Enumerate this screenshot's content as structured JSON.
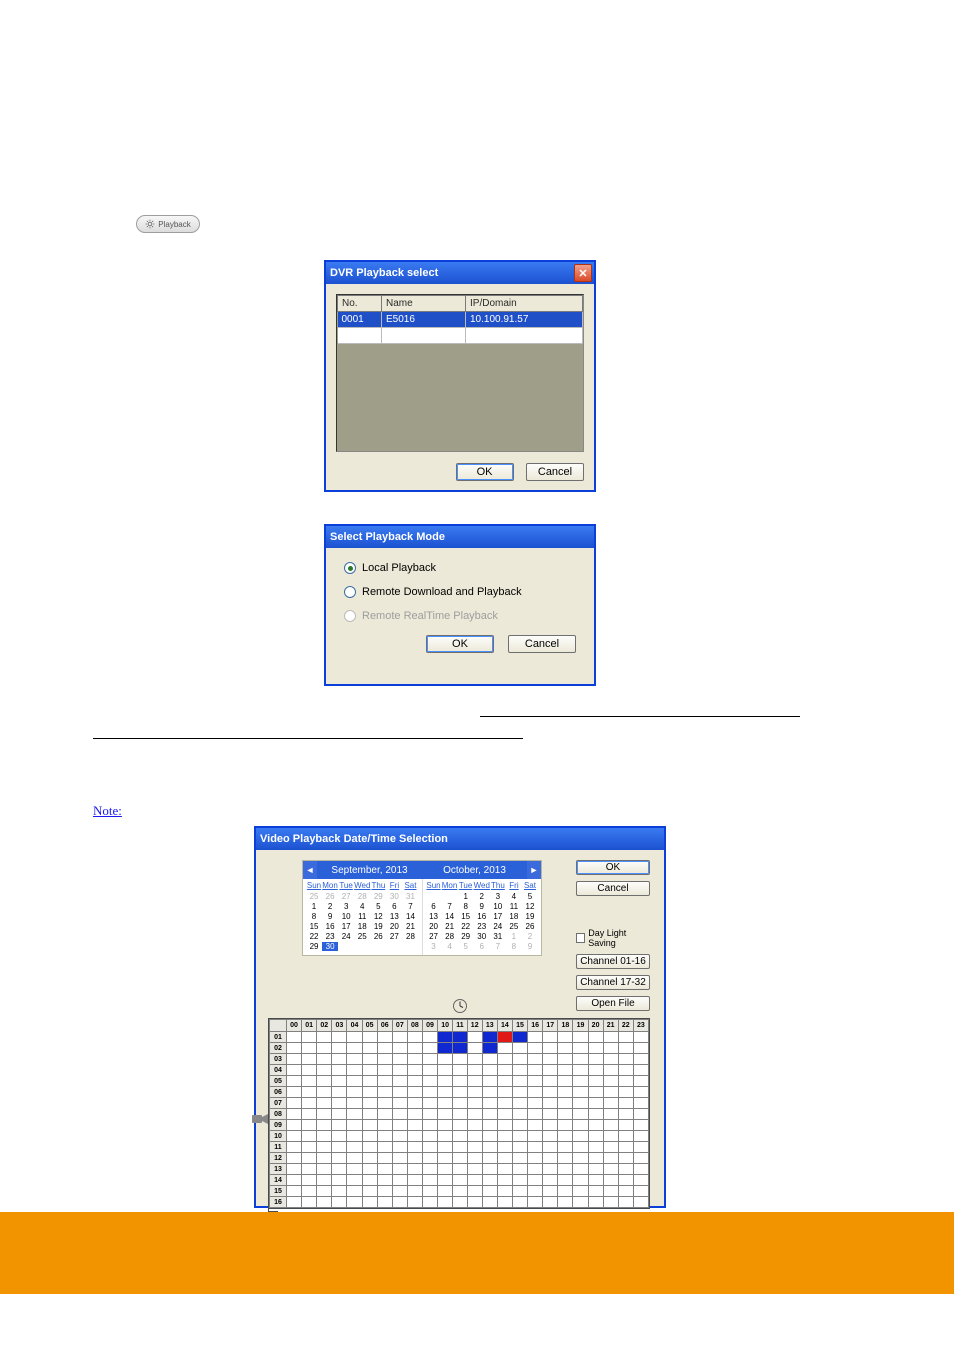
{
  "playback_button": {
    "label": "Playback",
    "icon": "gear-icon"
  },
  "dialog1": {
    "title": "DVR Playback select",
    "columns": [
      "No.",
      "Name",
      "IP/Domain"
    ],
    "rows": [
      {
        "no": "0001",
        "name": "E5016",
        "ip": "10.100.91.57",
        "selected": true
      }
    ],
    "ok": "OK",
    "cancel": "Cancel"
  },
  "dialog2": {
    "title": "Select Playback Mode",
    "options": [
      {
        "label": "Local Playback",
        "selected": true,
        "enabled": true
      },
      {
        "label": "Remote Download and Playback",
        "selected": false,
        "enabled": true
      },
      {
        "label": "Remote RealTime Playback",
        "selected": false,
        "enabled": false
      }
    ],
    "ok": "OK",
    "cancel": "Cancel"
  },
  "note": {
    "text": "Note:"
  },
  "dialog3": {
    "title": "Video Playback Date/Time Selection",
    "ok": "OK",
    "cancel": "Cancel",
    "daylight": "Day Light Saving",
    "ch1": "Channel 01-16",
    "ch2": "Channel 17-32",
    "openfile": "Open File",
    "calendar": {
      "left": {
        "title": "September, 2013",
        "dow": [
          "Sun",
          "Mon",
          "Tue",
          "Wed",
          "Thu",
          "Fri",
          "Sat"
        ],
        "cells": [
          {
            "v": "25",
            "m": 1
          },
          {
            "v": "26",
            "m": 1
          },
          {
            "v": "27",
            "m": 1
          },
          {
            "v": "28",
            "m": 1
          },
          {
            "v": "29",
            "m": 1
          },
          {
            "v": "30",
            "m": 1
          },
          {
            "v": "31",
            "m": 1
          },
          {
            "v": "1"
          },
          {
            "v": "2"
          },
          {
            "v": "3"
          },
          {
            "v": "4"
          },
          {
            "v": "5"
          },
          {
            "v": "6"
          },
          {
            "v": "7"
          },
          {
            "v": "8"
          },
          {
            "v": "9"
          },
          {
            "v": "10"
          },
          {
            "v": "11"
          },
          {
            "v": "12"
          },
          {
            "v": "13"
          },
          {
            "v": "14"
          },
          {
            "v": "15"
          },
          {
            "v": "16"
          },
          {
            "v": "17"
          },
          {
            "v": "18"
          },
          {
            "v": "19"
          },
          {
            "v": "20"
          },
          {
            "v": "21"
          },
          {
            "v": "22"
          },
          {
            "v": "23"
          },
          {
            "v": "24"
          },
          {
            "v": "25"
          },
          {
            "v": "26"
          },
          {
            "v": "27"
          },
          {
            "v": "28"
          },
          {
            "v": "29"
          },
          {
            "v": "30",
            "sel": 1
          },
          {
            "v": ""
          },
          {
            "v": ""
          },
          {
            "v": ""
          },
          {
            "v": ""
          },
          {
            "v": ""
          }
        ]
      },
      "right": {
        "title": "October, 2013",
        "dow": [
          "Sun",
          "Mon",
          "Tue",
          "Wed",
          "Thu",
          "Fri",
          "Sat"
        ],
        "cells": [
          {
            "v": ""
          },
          {
            "v": ""
          },
          {
            "v": "1"
          },
          {
            "v": "2"
          },
          {
            "v": "3"
          },
          {
            "v": "4"
          },
          {
            "v": "5"
          },
          {
            "v": "6"
          },
          {
            "v": "7"
          },
          {
            "v": "8"
          },
          {
            "v": "9"
          },
          {
            "v": "10"
          },
          {
            "v": "11"
          },
          {
            "v": "12"
          },
          {
            "v": "13"
          },
          {
            "v": "14"
          },
          {
            "v": "15"
          },
          {
            "v": "16"
          },
          {
            "v": "17"
          },
          {
            "v": "18"
          },
          {
            "v": "19"
          },
          {
            "v": "20"
          },
          {
            "v": "21"
          },
          {
            "v": "22"
          },
          {
            "v": "23"
          },
          {
            "v": "24"
          },
          {
            "v": "25"
          },
          {
            "v": "26"
          },
          {
            "v": "27"
          },
          {
            "v": "28"
          },
          {
            "v": "29"
          },
          {
            "v": "30"
          },
          {
            "v": "31"
          },
          {
            "v": "1",
            "m": 1
          },
          {
            "v": "2",
            "m": 1
          },
          {
            "v": "3",
            "m": 1
          },
          {
            "v": "4",
            "m": 1
          },
          {
            "v": "5",
            "m": 1
          },
          {
            "v": "6",
            "m": 1
          },
          {
            "v": "7",
            "m": 1
          },
          {
            "v": "8",
            "m": 1
          },
          {
            "v": "9",
            "m": 1
          }
        ]
      }
    },
    "timeline": {
      "hours": [
        "00",
        "01",
        "02",
        "03",
        "04",
        "05",
        "06",
        "07",
        "08",
        "09",
        "10",
        "11",
        "12",
        "13",
        "14",
        "15",
        "16",
        "17",
        "18",
        "19",
        "20",
        "21",
        "22",
        "23"
      ],
      "channels": [
        "01",
        "02",
        "03",
        "04",
        "05",
        "06",
        "07",
        "08",
        "09",
        "10",
        "11",
        "12",
        "13",
        "14",
        "15",
        "16"
      ],
      "marks": [
        {
          "channel": "01",
          "hour": "10",
          "color": "blue"
        },
        {
          "channel": "01",
          "hour": "11",
          "color": "blue"
        },
        {
          "channel": "01",
          "hour": "13",
          "color": "blue"
        },
        {
          "channel": "01",
          "hour": "14",
          "color": "red"
        },
        {
          "channel": "01",
          "hour": "15",
          "color": "blue"
        },
        {
          "channel": "02",
          "hour": "10",
          "color": "blue"
        },
        {
          "channel": "02",
          "hour": "11",
          "color": "blue"
        },
        {
          "channel": "02",
          "hour": "13",
          "color": "blue"
        }
      ]
    }
  },
  "colors": {
    "accent_blue": "#2a60d8",
    "record_blue": "#1028d0",
    "record_red": "#e01818",
    "footer_orange": "#f29400"
  }
}
